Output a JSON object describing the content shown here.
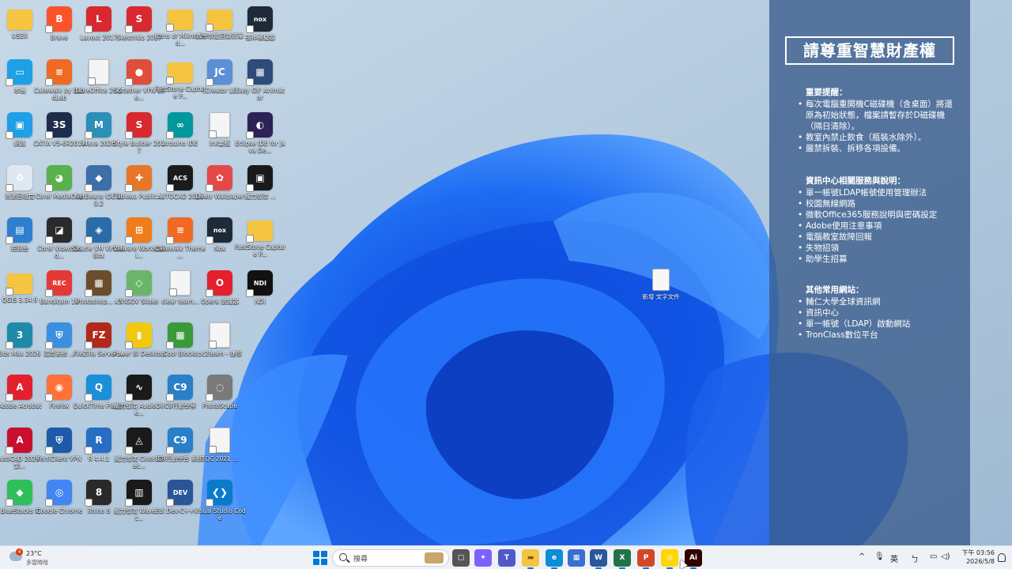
{
  "desktop": {
    "icons": [
      {
        "label": "USER",
        "color": "#f5c542",
        "kind": "folder"
      },
      {
        "label": "Brave",
        "color": "#fb542b",
        "kind": "app",
        "glyph": "B"
      },
      {
        "label": "Layout 2017",
        "color": "#d9282f",
        "kind": "app",
        "glyph": "L"
      },
      {
        "label": "SketchUp 2017",
        "color": "#d9282f",
        "kind": "app",
        "glyph": "S"
      },
      {
        "label": "Icons of Mikros Ind...",
        "color": "#f5c542",
        "kind": "folder"
      },
      {
        "label": "教學軟體目錄清單",
        "color": "#8fb3d9",
        "kind": "folder"
      },
      {
        "label": "夜神模擬器",
        "color": "#1f2a38",
        "kind": "app",
        "glyph": "nox"
      },
      {
        "label": "本機",
        "color": "#1ea0e6",
        "kind": "app",
        "glyph": "▭"
      },
      {
        "label": "Cakewalk by BandLab",
        "color": "#f06a24",
        "kind": "app",
        "glyph": "≡"
      },
      {
        "label": "LibreOffice 24.2",
        "color": "#e8e8e8",
        "kind": "file"
      },
      {
        "label": "Softether VPN Clie...",
        "color": "#e04d3a",
        "kind": "app",
        "glyph": "●"
      },
      {
        "label": "FastStone Capture P...",
        "color": "#f5c542",
        "kind": "folder"
      },
      {
        "label": "JCreator LE",
        "color": "#5b8fd6",
        "kind": "app",
        "glyph": "JC"
      },
      {
        "label": "Easy GIF Animator",
        "color": "#2f4b7c",
        "kind": "app",
        "glyph": "▦"
      },
      {
        "label": "網路",
        "color": "#1ea0e6",
        "kind": "app",
        "glyph": "▣"
      },
      {
        "label": "CATIA V5-6R2016",
        "color": "#1c2c4a",
        "kind": "app",
        "glyph": "3S"
      },
      {
        "label": "Maya 2026",
        "color": "#2c8fb8",
        "kind": "app",
        "glyph": "M"
      },
      {
        "label": "Style Builder 2017",
        "color": "#d9282f",
        "kind": "app",
        "glyph": "S"
      },
      {
        "label": "Arduino IDE",
        "color": "#00979d",
        "kind": "app",
        "glyph": "∞"
      },
      {
        "label": "Ink畫板",
        "color": "#e8e8e8",
        "kind": "file"
      },
      {
        "label": "Eclipse IDE for Java De...",
        "color": "#2c2255",
        "kind": "app",
        "glyph": "◐"
      },
      {
        "label": "資源回收筒",
        "color": "#dfe8f0",
        "kind": "app",
        "glyph": "♻"
      },
      {
        "label": "Corel MediaOne",
        "color": "#58b14a",
        "kind": "app",
        "glyph": "◕"
      },
      {
        "label": "NetBeans IDE 8.0.2",
        "color": "#3c6ea8",
        "kind": "app",
        "glyph": "◆"
      },
      {
        "label": "Tableau Public ...",
        "color": "#e97627",
        "kind": "app",
        "glyph": "✚"
      },
      {
        "label": "AUTOCAD 2026",
        "color": "#1b1b1b",
        "kind": "app",
        "glyph": "ACS"
      },
      {
        "label": "Lively Wallpaper",
        "color": "#e54848",
        "kind": "app",
        "glyph": "✿"
      },
      {
        "label": "威力導演 ...",
        "color": "#1a1a1a",
        "kind": "app",
        "glyph": "▣"
      },
      {
        "label": "控制台",
        "color": "#2d7fd0",
        "kind": "app",
        "glyph": "▤"
      },
      {
        "label": "Corel VideoStud...",
        "color": "#2a2a2a",
        "kind": "app",
        "glyph": "◪"
      },
      {
        "label": "Oracle VM VirtualBox",
        "color": "#2b6ba8",
        "kind": "app",
        "glyph": "◈"
      },
      {
        "label": "VMware Workstati...",
        "color": "#f07c1a",
        "kind": "app",
        "glyph": "⊞"
      },
      {
        "label": "Cakewalk Theme ...",
        "color": "#f06a24",
        "kind": "app",
        "glyph": "≡"
      },
      {
        "label": "Nox",
        "color": "#1f2a38",
        "kind": "app",
        "glyph": "nox"
      },
      {
        "label": "FastStone Capture P...",
        "color": "#f5c542",
        "kind": "folder"
      },
      {
        "label": "QGIS 3.34.9",
        "color": "#f5c542",
        "kind": "folder"
      },
      {
        "label": "Bandicam 10",
        "color": "#e53935",
        "kind": "app",
        "glyph": "REC"
      },
      {
        "label": "Photoshop... x3",
        "color": "#6b4d2e",
        "kind": "app",
        "glyph": "▦"
      },
      {
        "label": "VIGOV Slides",
        "color": "#6bb56a",
        "kind": "app",
        "glyph": "◇"
      },
      {
        "label": "clear team...",
        "color": "#eeeeee",
        "kind": "file"
      },
      {
        "label": "Opera 瀏覽器",
        "color": "#e4202e",
        "kind": "app",
        "glyph": "O"
      },
      {
        "label": "NDI",
        "color": "#111111",
        "kind": "app",
        "glyph": "NDI"
      },
      {
        "label": "3ds Max 2026",
        "color": "#1f8aa8",
        "kind": "app",
        "glyph": "3"
      },
      {
        "label": "還原系統 ...",
        "color": "#3b8fe0",
        "kind": "app",
        "glyph": "⛨"
      },
      {
        "label": "FileZilla Server ...",
        "color": "#b2281b",
        "kind": "app",
        "glyph": "FZ"
      },
      {
        "label": "Power BI Desktop",
        "color": "#f2c811",
        "kind": "app",
        "glyph": "▮"
      },
      {
        "label": "Cool Blocks",
        "color": "#3a9a3a",
        "kind": "app",
        "glyph": "▦"
      },
      {
        "label": "pc2team - 捷徑",
        "color": "#eeeeee",
        "kind": "file"
      },
      {
        "label": "Adobe Acrobat",
        "color": "#e3202e",
        "kind": "app",
        "glyph": "A"
      },
      {
        "label": "Firefox",
        "color": "#ff7139",
        "kind": "app",
        "glyph": "◉"
      },
      {
        "label": "QuickTime Player",
        "color": "#1b8fd8",
        "kind": "app",
        "glyph": "Q"
      },
      {
        "label": "威力導演 AudioDire...",
        "color": "#1a1a1a",
        "kind": "app",
        "glyph": "∿"
      },
      {
        "label": "C9行動學堂",
        "color": "#2b7fc8",
        "kind": "app",
        "glyph": "C9"
      },
      {
        "label": "PhotoScape",
        "color": "#7a7a7a",
        "kind": "app",
        "glyph": "◌"
      },
      {
        "label": "AutoCAD 2026 - 繁...",
        "color": "#c8102e",
        "kind": "app",
        "glyph": "A"
      },
      {
        "label": "FortiClient VPN",
        "color": "#1e5aa8",
        "kind": "app",
        "glyph": "⛨"
      },
      {
        "label": "R 4.4.1",
        "color": "#276dc3",
        "kind": "app",
        "glyph": "R"
      },
      {
        "label": "威力導演 ColorDirec...",
        "color": "#1a1a1a",
        "kind": "app",
        "glyph": "◬"
      },
      {
        "label": "C9行動學習 系統",
        "color": "#2b7fc8",
        "kind": "app",
        "glyph": "C9"
      },
      {
        "label": "TQC 2021 ...",
        "color": "#f2f2f2",
        "kind": "file"
      },
      {
        "label": "BlueStacks X",
        "color": "#2fbf5a",
        "kind": "app",
        "glyph": "◆"
      },
      {
        "label": "Google Chrome",
        "color": "#4285f4",
        "kind": "app",
        "glyph": "◎"
      },
      {
        "label": "Rhino 8",
        "color": "#2a2a2a",
        "kind": "app",
        "glyph": "8"
      },
      {
        "label": "威力導演 WaveEdit...",
        "color": "#1a1a1a",
        "kind": "app",
        "glyph": "▥"
      },
      {
        "label": "Dev-C++",
        "color": "#2a5599",
        "kind": "app",
        "glyph": "DEV"
      },
      {
        "label": "Visual Studio Code",
        "color": "#0a7acc",
        "kind": "app",
        "glyph": "❮❯"
      }
    ],
    "new_file_label": "新增 文字文件"
  },
  "panel": {
    "title": "請尊重智慧財產權",
    "sections": [
      {
        "heading": "重要提醒：",
        "items": [
          "每次電腦重開機C磁碟機（含桌面）將還原為初始狀態，檔案請暫存於D磁碟機（隔日清除）。",
          "教室內禁止飲食（瓶裝水除外）。",
          "嚴禁拆裝、拆移各項設備。"
        ]
      },
      {
        "heading": "資訊中心相關服務與說明：",
        "items": [
          "單一帳號LDAP帳號使用管理辦法",
          "校園無線網路",
          "微軟Office365服務說明與密碼設定",
          "Adobe使用注意事項",
          "電腦教室故障回報",
          "失物招領",
          "助學生招募"
        ]
      },
      {
        "heading": "其他常用網站：",
        "items": [
          "輔仁大學全球資訊網",
          "資訊中心",
          "單一帳號（LDAP）啟動網站",
          "TronClass數位平台"
        ]
      }
    ]
  },
  "taskbar": {
    "weather": {
      "temp": "23°C",
      "desc": "多雲時陰",
      "badge": "4"
    },
    "search_label": "搜尋",
    "apps": [
      {
        "name": "task-view",
        "color": "#555555",
        "glyph": "▢"
      },
      {
        "name": "copilot",
        "color": "#7b61ff",
        "glyph": "✦"
      },
      {
        "name": "teams",
        "color": "#5059c9",
        "glyph": "T"
      },
      {
        "name": "file-explorer",
        "color": "#f5c542",
        "glyph": "▬"
      },
      {
        "name": "edge",
        "color": "#0c8dd8",
        "glyph": "e"
      },
      {
        "name": "microsoft-store",
        "color": "#3a6fd0",
        "glyph": "▦"
      },
      {
        "name": "word",
        "color": "#2b579a",
        "glyph": "W"
      },
      {
        "name": "excel",
        "color": "#217346",
        "glyph": "X"
      },
      {
        "name": "powerpoint",
        "color": "#d24726",
        "glyph": "P"
      },
      {
        "name": "chrome",
        "color": "#ffd600",
        "glyph": "◎"
      },
      {
        "name": "illustrator",
        "color": "#330000",
        "glyph": "Ai"
      }
    ],
    "tray": {
      "chevron": "^",
      "ime": "英",
      "clock_time": "下午 03:56",
      "clock_date": "2026/5/8"
    }
  },
  "colors": {
    "accent": "#0078d4",
    "panel_bg": "#3a5c8c"
  }
}
